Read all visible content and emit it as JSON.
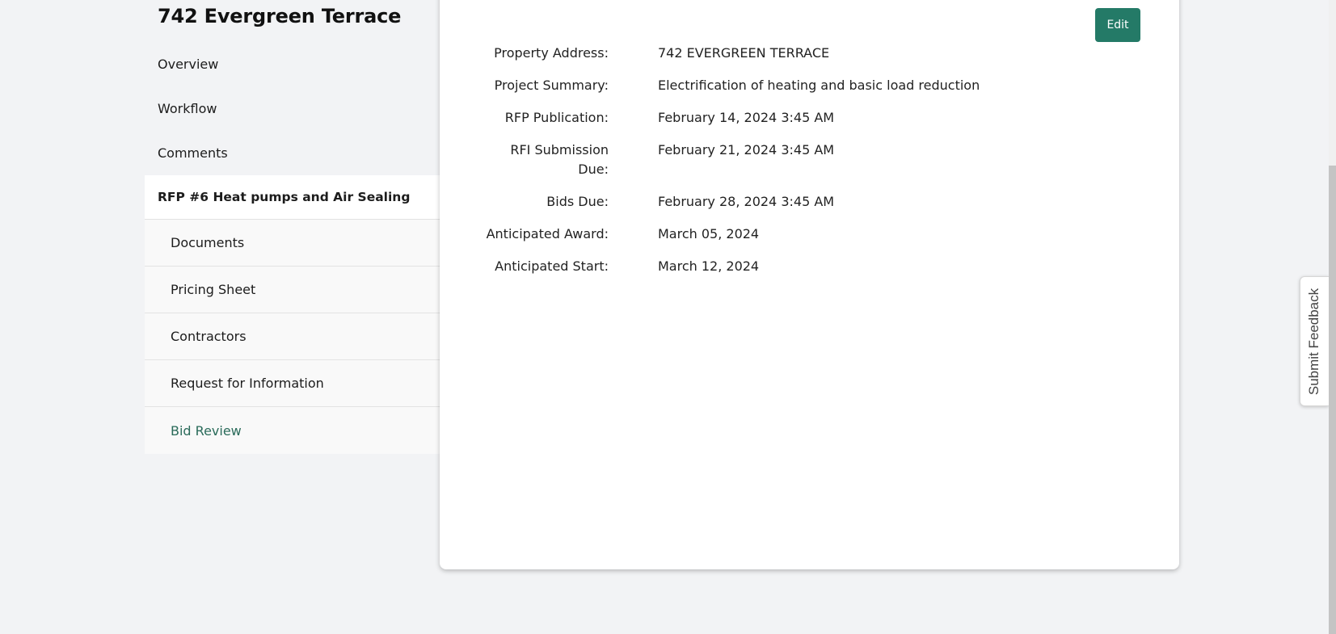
{
  "property": {
    "title": "742 Evergreen Terrace"
  },
  "nav": {
    "items": [
      {
        "label": "Overview"
      },
      {
        "label": "Workflow"
      },
      {
        "label": "Comments"
      }
    ],
    "active_rfp": {
      "label": "RFP #6 Heat pumps and Air Sealing"
    },
    "sub_items": [
      {
        "label": "Documents"
      },
      {
        "label": "Pricing Sheet"
      },
      {
        "label": "Contractors"
      },
      {
        "label": "Request for Information"
      },
      {
        "label": "Bid Review"
      }
    ],
    "link_color": "#2a6b5a"
  },
  "card": {
    "edit_label": "Edit",
    "accent_color": "#247a67",
    "fields": [
      {
        "label": "Property Address:",
        "value": "742 EVERGREEN TERRACE"
      },
      {
        "label": "Project Summary:",
        "value": "Electrification of heating and basic load reduction"
      },
      {
        "label": "RFP Publication:",
        "value": "February 14, 2024 3:45 AM"
      },
      {
        "label": "RFI Submission Due:",
        "value": "February 21, 2024 3:45 AM"
      },
      {
        "label": "Bids Due:",
        "value": "February 28, 2024 3:45 AM"
      },
      {
        "label": "Anticipated Award:",
        "value": "March 05, 2024"
      },
      {
        "label": "Anticipated Start:",
        "value": "March 12, 2024"
      }
    ]
  },
  "feedback": {
    "label": "Submit Feedback"
  }
}
